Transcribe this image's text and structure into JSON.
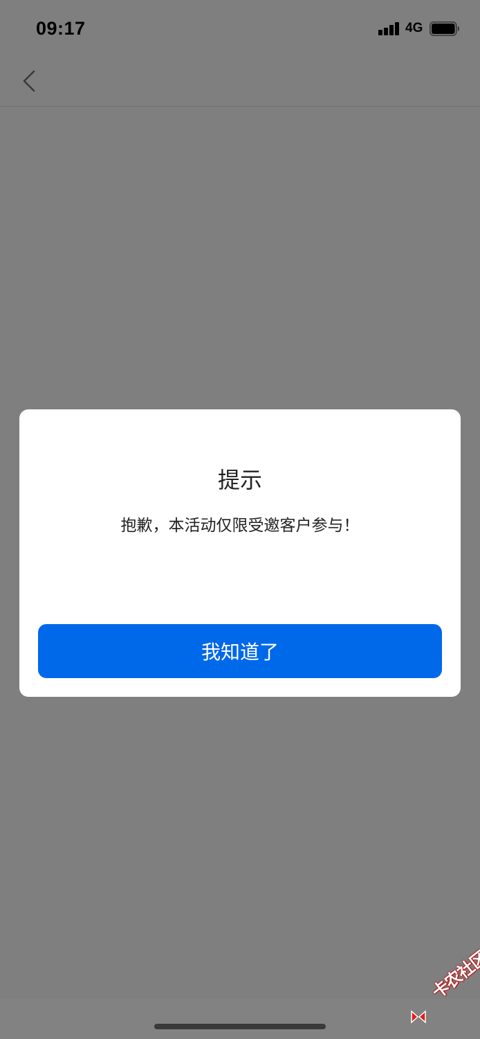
{
  "status_bar": {
    "time": "09:17",
    "network": "4G",
    "signal_icon": "cellular-signal-icon",
    "battery_icon": "battery-icon"
  },
  "nav_bar": {
    "back_icon": "chevron-left-icon"
  },
  "dialog": {
    "title": "提示",
    "message": "抱歉，本活动仅限受邀客户参与！",
    "confirm_label": "我知道了"
  },
  "watermark": {
    "text": "卡农社区"
  },
  "colors": {
    "overlay": "#7f7f7f",
    "primary_button": "#0069ea",
    "dialog_bg": "#ffffff",
    "watermark": "#e02020"
  }
}
